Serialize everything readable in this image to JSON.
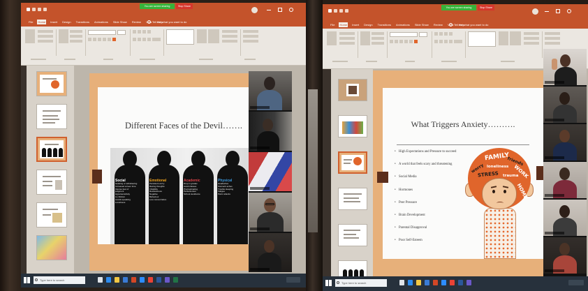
{
  "left_window": {
    "share_bar": {
      "status": "You are screen sharing",
      "stop": "Stop Share"
    },
    "tabs": [
      "File",
      "Home",
      "Insert",
      "Design",
      "Transitions",
      "Animations",
      "Slide Show",
      "Review",
      "View",
      "Help"
    ],
    "active_tab": "Home",
    "tell_me": "Tell me what you want to do",
    "slide": {
      "title": "Different Faces of the Devil…….",
      "columns": [
        {
          "heading": "Social",
          "color": "#ffffff",
          "lines": [
            "Isolating or withdrawing",
            "Increased screen time",
            "Intense fear of",
            "judgment",
            "Hypersensitivity",
            "to criticism",
            "Avoids speaking",
            "Loneliness"
          ]
        },
        {
          "heading": "Emotional",
          "color": "#f2a51f",
          "lines": [
            "Persistent worry",
            "Racing thoughts",
            "Irritability",
            "Restlessness",
            "Negative",
            "Behaviour",
            "Low concentration"
          ]
        },
        {
          "heading": "Academic",
          "color": "#e0434a",
          "lines": [
            "Drop in grades",
            "Avoid classes",
            "Procrastinating",
            "Perfectionism",
            "School avoidance"
          ]
        },
        {
          "heading": "Physical",
          "color": "#3e9be0",
          "lines": [
            "Headaches",
            "Stomach aches",
            "Trouble sleeping",
            "Fatigue",
            "Panic attacks"
          ]
        }
      ]
    },
    "taskbar": {
      "search": "Type here to search"
    }
  },
  "right_window": {
    "share_bar": {
      "status": "You are screen sharing",
      "stop": "Stop Share"
    },
    "tabs": [
      "File",
      "Home",
      "Insert",
      "Design",
      "Transitions",
      "Animations",
      "Slide Show",
      "Review",
      "View",
      "Help"
    ],
    "active_tab": "Home",
    "tell_me": "Tell me what you want to do",
    "slide": {
      "title": "What Triggers Anxiety……….",
      "bullets": [
        "High Expectations and Pressure to succeed",
        "A world that feels scary and threatening",
        "Social Media",
        "Hormones",
        "Peer Pressure",
        "Brain Development",
        "Parental Disapproval",
        "Poor Self-Esteem"
      ],
      "word_cloud": [
        "FAMILY",
        "friends",
        "WORK",
        "worry",
        "loneliness",
        "STRESS",
        "trauma",
        "HOME"
      ]
    },
    "taskbar": {
      "search": "Type here to search"
    }
  },
  "colors": {
    "title_bar": "#c4532b",
    "share_green": "#37b33a",
    "stop_red": "#d5362c",
    "slide_border": "#e7b07a",
    "hair_orange": "#e0652b"
  }
}
